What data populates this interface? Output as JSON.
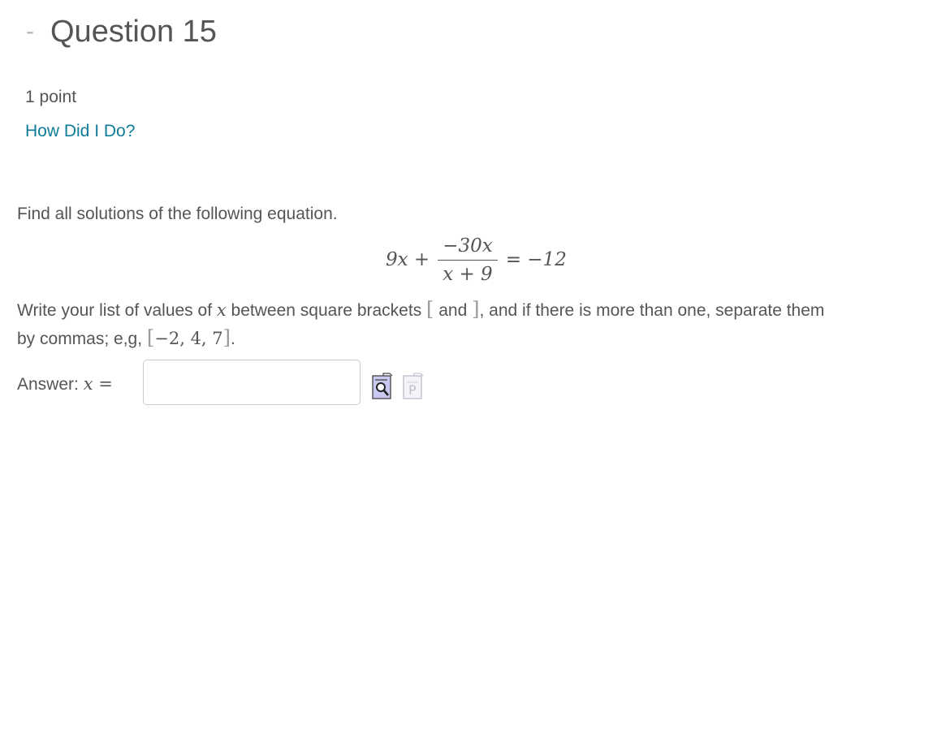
{
  "question": {
    "collapse_symbol": "-",
    "title": "Question 15",
    "points": "1 point",
    "how_did_i_do": "How Did I Do?"
  },
  "problem": {
    "prompt": "Find all solutions of the following equation.",
    "equation": {
      "lhs_term": "9x +",
      "numerator": "−30x",
      "denominator": "x + 9",
      "rhs": "= −12"
    },
    "instructions": {
      "part1": "Write your list of values of ",
      "var": "x",
      "part2": " between square brackets ",
      "open_bracket": "[",
      "and_word": " and ",
      "close_bracket": "]",
      "part3": ", and if there is more than one, separate them",
      "part4": "by commas; e,g, ",
      "example": "−2, 4, 7",
      "end": "."
    }
  },
  "answer": {
    "label": "Answer: ",
    "var": "x",
    "equals": " =",
    "value": "",
    "placeholder": ""
  },
  "icons": {
    "preview": "preview-equation-icon",
    "paste": "paste-icon"
  },
  "colors": {
    "link": "#0e7c99",
    "text": "#555555",
    "icon_fill": "#c8c8f0"
  }
}
